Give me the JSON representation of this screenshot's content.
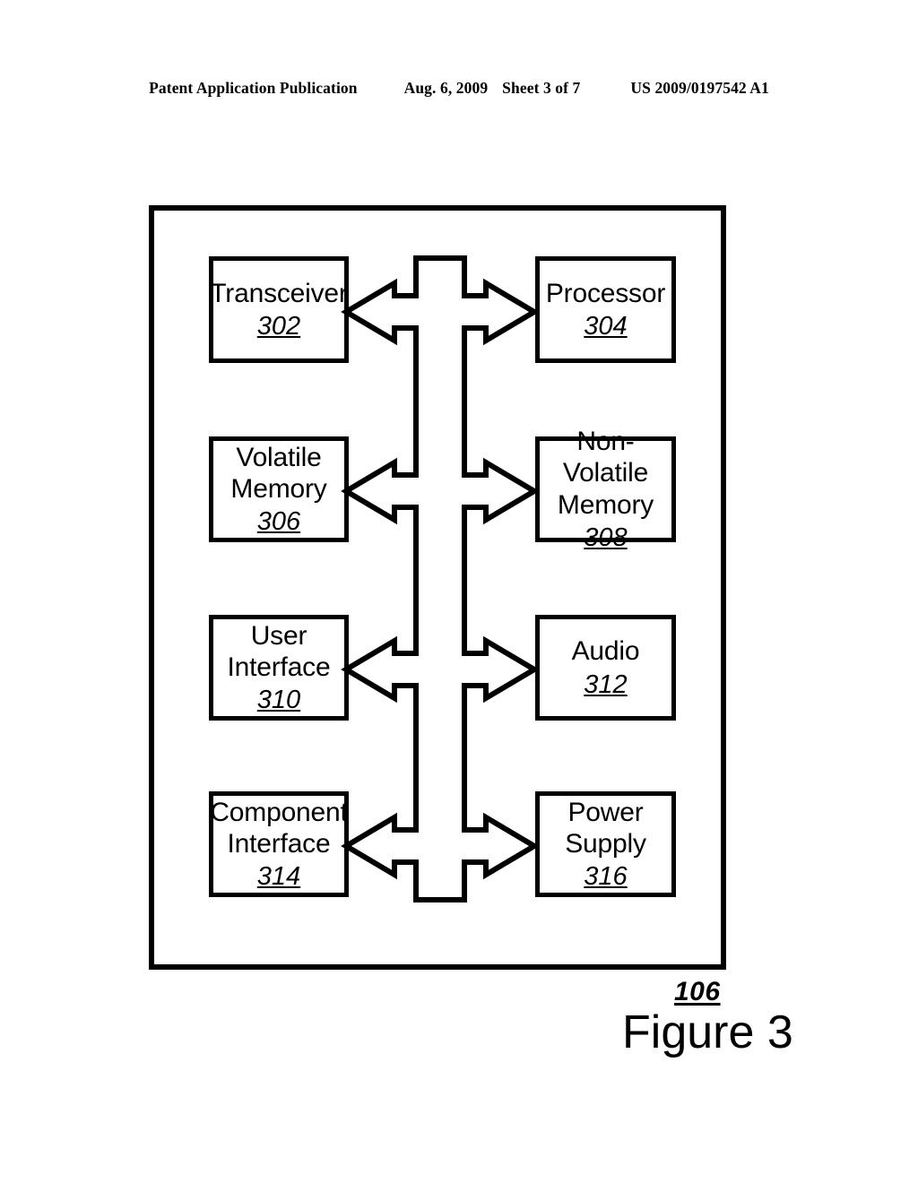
{
  "header": {
    "publication": "Patent Application Publication",
    "date": "Aug. 6, 2009",
    "sheet": "Sheet 3 of 7",
    "patent_number": "US 2009/0197542 A1"
  },
  "figure": {
    "caption": "Figure 3",
    "container_ref": "106",
    "container_name": "device-block-diagram"
  },
  "diagram": {
    "type": "block-diagram",
    "colors": {
      "stroke": "#000000",
      "fill": "#ffffff",
      "page_background": "#ffffff"
    },
    "blocks": [
      {
        "id": "transceiver",
        "ref": "302",
        "lines": [
          "Transceiver"
        ],
        "column": "left",
        "row": 1
      },
      {
        "id": "processor",
        "ref": "304",
        "lines": [
          "Processor"
        ],
        "column": "right",
        "row": 1
      },
      {
        "id": "volatile-memory",
        "ref": "306",
        "lines": [
          "Volatile",
          "Memory"
        ],
        "column": "left",
        "row": 2
      },
      {
        "id": "non-volatile-memory",
        "ref": "308",
        "lines": [
          "Non-Volatile",
          "Memory"
        ],
        "column": "right",
        "row": 2
      },
      {
        "id": "user-interface",
        "ref": "310",
        "lines": [
          "User",
          "Interface"
        ],
        "column": "left",
        "row": 3
      },
      {
        "id": "audio",
        "ref": "312",
        "lines": [
          "Audio"
        ],
        "column": "right",
        "row": 3
      },
      {
        "id": "component-interface",
        "ref": "314",
        "lines": [
          "Component",
          "Interface"
        ],
        "column": "left",
        "row": 4
      },
      {
        "id": "power-supply",
        "ref": "316",
        "lines": [
          "Power",
          "Supply"
        ],
        "column": "right",
        "row": 4
      }
    ],
    "bus": {
      "name": "bidirectional-system-bus",
      "style": "hollow-block-arrow",
      "connections": [
        {
          "left": "transceiver",
          "right": "processor",
          "bidirectional": true
        },
        {
          "left": "volatile-memory",
          "right": "non-volatile-memory",
          "bidirectional": true
        },
        {
          "left": "user-interface",
          "right": "audio",
          "bidirectional": true
        },
        {
          "left": "component-interface",
          "right": "power-supply",
          "bidirectional": true
        }
      ]
    }
  }
}
